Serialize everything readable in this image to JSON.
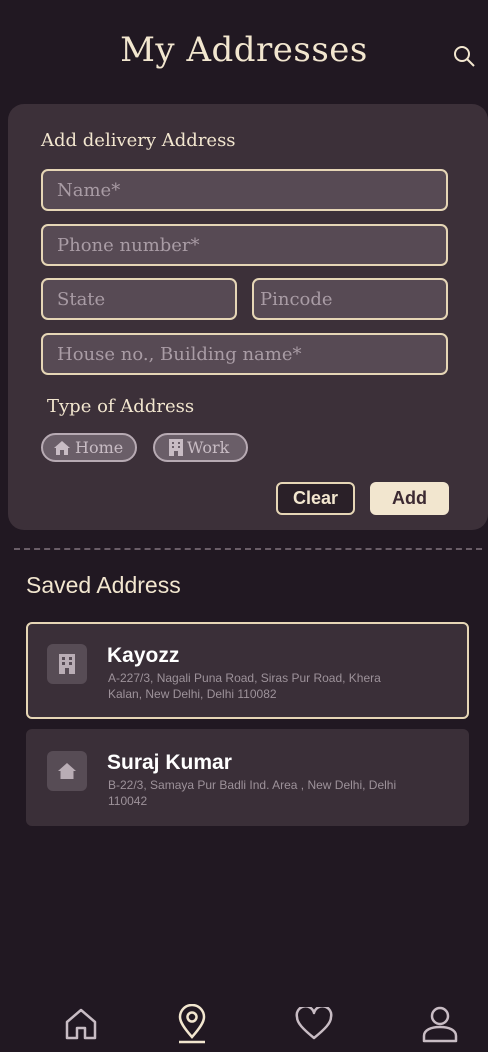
{
  "header": {
    "title": "My Addresses",
    "search_icon": "search-icon"
  },
  "form": {
    "heading": "Add delivery Address",
    "name_placeholder": "Name*",
    "phone_placeholder": "Phone number*",
    "state_placeholder": "State",
    "pincode_placeholder": "Pincode",
    "house_placeholder": "House no., Building name*",
    "type_heading": "Type of Address",
    "types": [
      {
        "label": "Home",
        "icon": "home-icon"
      },
      {
        "label": "Work",
        "icon": "building-icon"
      }
    ],
    "clear_label": "Clear",
    "add_label": "Add"
  },
  "saved": {
    "heading": "Saved Address",
    "addresses": [
      {
        "name": "Kayozz",
        "address": "A-227/3, Nagali Puna Road, Siras Pur Road, Khera Kalan, New Delhi, Delhi 110082",
        "icon": "building-icon",
        "selected": true
      },
      {
        "name": "Suraj Kumar",
        "address": "B-22/3, Samaya Pur Badli Ind. Area , New Delhi, Delhi 110042",
        "icon": "home-icon",
        "selected": false
      }
    ]
  },
  "nav": {
    "items": [
      "home-icon",
      "location-pin-icon",
      "heart-icon",
      "user-icon"
    ],
    "active": "location-pin-icon"
  },
  "colors": {
    "background": "#211822",
    "card": "#3c3039",
    "accent": "#f2e6cf"
  }
}
